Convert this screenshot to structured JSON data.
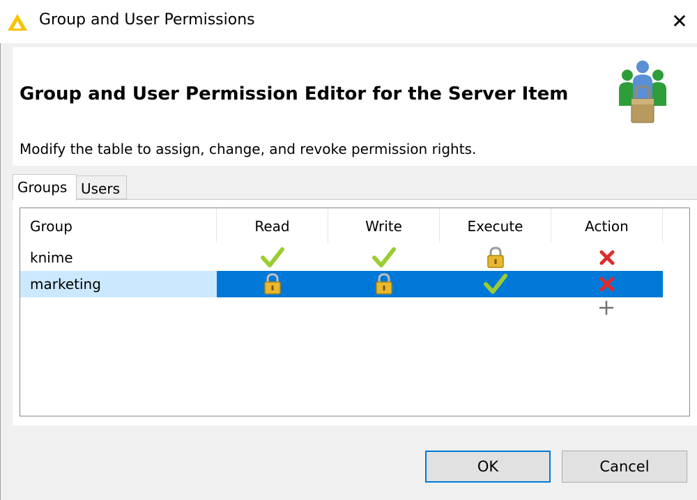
{
  "window": {
    "title": "Group and User Permissions",
    "close_symbol": "✕",
    "app_icon": "knime-warning-triangle-icon"
  },
  "banner": {
    "title": "Group and User Permission Editor for the Server Item",
    "description": "Modify the table to assign, change, and revoke permission rights.",
    "icon": "group-permissions-lock-icon"
  },
  "tabs": [
    {
      "label": "Groups",
      "selected": true
    },
    {
      "label": "Users",
      "selected": false
    }
  ],
  "table": {
    "columns": [
      "Group",
      "Read",
      "Write",
      "Execute",
      "Action"
    ],
    "rows": [
      {
        "name": "knime",
        "read": "check",
        "write": "check",
        "execute": "lock",
        "action": "delete",
        "selected": false
      },
      {
        "name": "marketing",
        "read": "lock",
        "write": "lock",
        "execute": "check",
        "action": "delete",
        "selected": true
      }
    ],
    "add_icon": "plus-icon"
  },
  "buttons": {
    "ok": "OK",
    "cancel": "Cancel"
  },
  "colors": {
    "selection_blue": "#0078d7",
    "selection_light": "#cce8ff",
    "check_green": "#9acd32",
    "delete_red": "#e02a2a",
    "lock_gold": "#d9a520"
  }
}
